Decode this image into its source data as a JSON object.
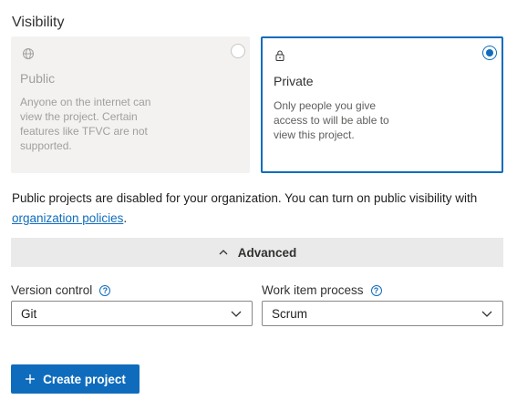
{
  "visibility": {
    "label": "Visibility",
    "public": {
      "icon": "globe-icon",
      "title": "Public",
      "description": "Anyone on the internet can view the project. Certain features like TFVC are not supported.",
      "selected": false
    },
    "private": {
      "icon": "lock-icon",
      "title": "Private",
      "description": "Only people you give access to will be able to view this project.",
      "selected": true
    }
  },
  "notice": {
    "text": "Public projects are disabled for your organization. You can turn on public visibility with",
    "link_text": "organization policies",
    "suffix": "."
  },
  "advanced": {
    "label": "Advanced",
    "icon": "chevron-up-icon"
  },
  "version_control": {
    "label": "Version control",
    "help_icon": "help-icon",
    "value": "Git"
  },
  "work_item_process": {
    "label": "Work item process",
    "help_icon": "help-icon",
    "value": "Scrum"
  },
  "create_button": {
    "label": "Create project",
    "icon": "plus-icon"
  },
  "colors": {
    "accent": "#0f6cbd",
    "disabled_card_bg": "#f3f2f1",
    "advanced_bar_bg": "#eaeaea"
  }
}
